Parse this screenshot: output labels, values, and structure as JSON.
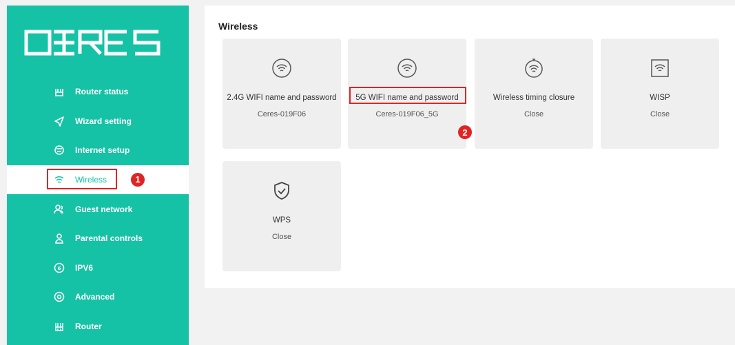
{
  "brand": {
    "logo_text": "CERES"
  },
  "sidebar": {
    "items": [
      {
        "label": "Router status",
        "icon": "router-status-icon"
      },
      {
        "label": "Wizard setting",
        "icon": "send-icon"
      },
      {
        "label": "Internet setup",
        "icon": "globe-icon"
      },
      {
        "label": "Wireless",
        "icon": "wifi-icon"
      },
      {
        "label": "Guest network",
        "icon": "guests-icon"
      },
      {
        "label": "Parental controls",
        "icon": "user-icon"
      },
      {
        "label": "IPV6",
        "icon": "ipv6-icon"
      },
      {
        "label": "Advanced",
        "icon": "target-icon"
      },
      {
        "label": "Router",
        "icon": "router-icon"
      }
    ],
    "active_index": 3
  },
  "main": {
    "title": "Wireless",
    "cards": [
      {
        "name": "2.4G WIFI name and password",
        "value": "Ceres-019F06"
      },
      {
        "name": "5G WIFI name and password",
        "value": "Ceres-019F06_5G"
      },
      {
        "name": "Wireless timing closure",
        "value": "Close"
      },
      {
        "name": "WISP",
        "value": "Close"
      },
      {
        "name": "WPS",
        "value": "Close"
      }
    ]
  },
  "annotations": {
    "step1": "1",
    "step2": "2"
  },
  "colors": {
    "accent": "#16c2a6",
    "highlight": "#e02424",
    "card_bg": "#efefef"
  }
}
